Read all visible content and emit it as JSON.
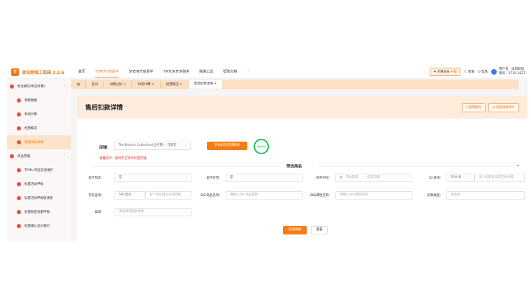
{
  "app": {
    "name": "凌风跨境工具箱 3.2.6",
    "logo_letter": "T"
  },
  "nav": [
    "首页",
    "TEMU开店助手",
    "SHEIN开店助手",
    "TIKTOK开店助手",
    "跨境工具",
    "帮助文档",
    "···"
  ],
  "topright": {
    "vip": "至尊会员",
    "upgrade": "升级",
    "service": "客服",
    "help": "帮助",
    "username": "用户名：凌风跨境",
    "account": "账号：1730 1027"
  },
  "tabs": [
    "首页",
    "动销分析",
    "利润计算",
    "经营概况",
    "售后扣款详情"
  ],
  "sidebar": [
    {
      "label": "财务模块(利润计算)",
      "group": true
    },
    {
      "label": "销售数据"
    },
    {
      "label": "利润计算"
    },
    {
      "label": "经营概况"
    },
    {
      "label": "售后扣款详情",
      "active": true
    },
    {
      "label": "商品管理",
      "group": true
    },
    {
      "label": "TEMU 商品信息维护"
    },
    {
      "label": "批量活动申报"
    },
    {
      "label": "批量活动申报极速版"
    },
    {
      "label": "批量催促批量申报"
    },
    {
      "label": "批量确认竞价邀约"
    }
  ],
  "page": {
    "title": "售后扣款详情",
    "tutorial": "使用教程",
    "video": "观看视频简介",
    "shop_label": "店铺：",
    "shop_value": "The Market Collective(全托管) - 已绑定",
    "sync": "开始同步店铺数据",
    "status": "授权成功",
    "warning": "温馨提示：暂时不支持半托管店铺",
    "section": "筛选商品"
  },
  "filters": {
    "hot": {
      "label": "是否热卖:",
      "value": "是"
    },
    "onsale": {
      "label": "是否在售:",
      "value": "是"
    },
    "time": {
      "label": "财务时间:",
      "start": "开始日期",
      "sep": "-",
      "end": "结束日期"
    },
    "id": {
      "label": "ID 查询:",
      "type": "SPU ID",
      "placeholder": "多个ID用逗号或空格分隔"
    },
    "code": {
      "label": "货号查询:",
      "type": "SKC货号",
      "placeholder": "多个货号用逗号或空格"
    },
    "skc": {
      "label": "SKC商品名称:",
      "placeholder": "请输入SKC商品名称"
    },
    "sku": {
      "label": "SKU属性名称:",
      "placeholder": "请输入SKU属性名称"
    },
    "deduct": {
      "label": "扣款类型:",
      "placeholder": "请选择"
    },
    "cat": {
      "label": "类目:",
      "placeholder": "请选择或搜索类目"
    },
    "submit": "筛选数据",
    "reset": "重置"
  },
  "colors": {
    "accent": "#f57c14",
    "success": "#22c05a"
  }
}
